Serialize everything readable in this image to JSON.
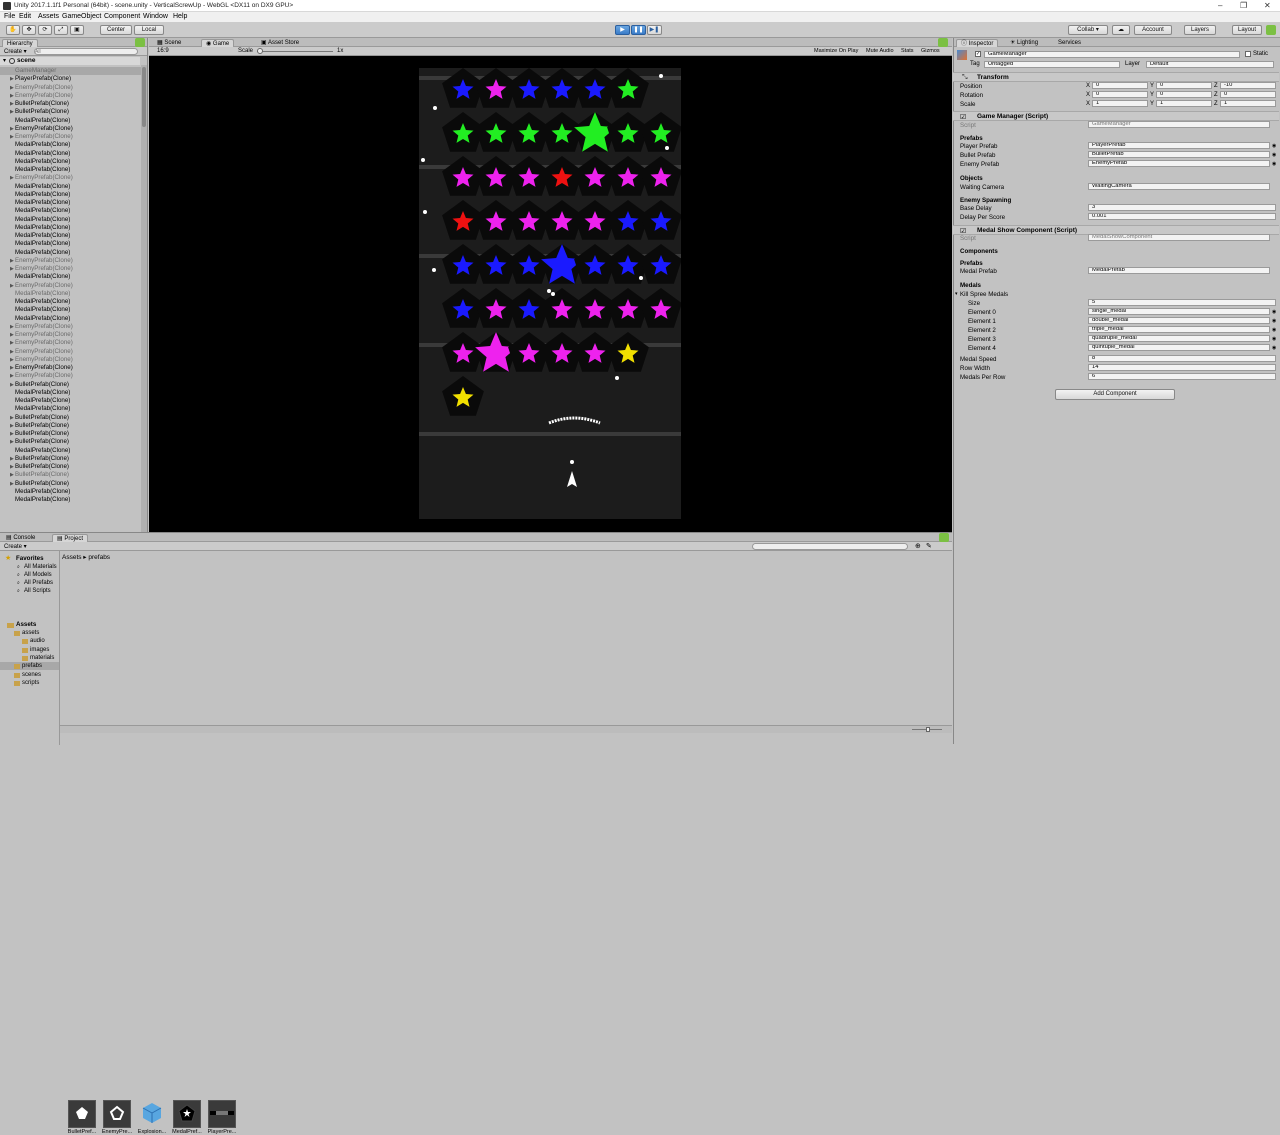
{
  "window": {
    "title": "Unity 2017.1.1f1 Personal (64bit) - scene.unity - VerticalScrewUp - WebGL <DX11 on DX9 GPU>"
  },
  "menu": [
    "File",
    "Edit",
    "Assets",
    "GameObject",
    "Component",
    "Window",
    "Help"
  ],
  "toolbar": {
    "pivot": "Center",
    "space": "Local",
    "collab": "Collab ▾",
    "account": "Account",
    "layers": "Layers",
    "layout": "Layout"
  },
  "hierarchy": {
    "tab": "Hierarchy",
    "create": "Create ▾",
    "search_placeholder": "All",
    "scene": "scene",
    "items": [
      {
        "label": "GameManager",
        "gray": false,
        "arrow": false,
        "selected": true
      },
      {
        "label": "PlayerPrefab(Clone)",
        "gray": false,
        "arrow": true
      },
      {
        "label": "EnemyPrefab(Clone)",
        "gray": true,
        "arrow": true
      },
      {
        "label": "EnemyPrefab(Clone)",
        "gray": true,
        "arrow": true
      },
      {
        "label": "BulletPrefab(Clone)",
        "gray": false,
        "arrow": true
      },
      {
        "label": "BulletPrefab(Clone)",
        "gray": false,
        "arrow": true
      },
      {
        "label": "MedalPrefab(Clone)",
        "gray": false,
        "arrow": false
      },
      {
        "label": "EnemyPrefab(Clone)",
        "gray": false,
        "arrow": true
      },
      {
        "label": "EnemyPrefab(Clone)",
        "gray": true,
        "arrow": true
      },
      {
        "label": "MedalPrefab(Clone)",
        "gray": false,
        "arrow": false
      },
      {
        "label": "MedalPrefab(Clone)",
        "gray": false,
        "arrow": false
      },
      {
        "label": "MedalPrefab(Clone)",
        "gray": false,
        "arrow": false
      },
      {
        "label": "MedalPrefab(Clone)",
        "gray": false,
        "arrow": false
      },
      {
        "label": "EnemyPrefab(Clone)",
        "gray": true,
        "arrow": true
      },
      {
        "label": "MedalPrefab(Clone)",
        "gray": false,
        "arrow": false
      },
      {
        "label": "MedalPrefab(Clone)",
        "gray": false,
        "arrow": false
      },
      {
        "label": "MedalPrefab(Clone)",
        "gray": false,
        "arrow": false
      },
      {
        "label": "MedalPrefab(Clone)",
        "gray": false,
        "arrow": false
      },
      {
        "label": "MedalPrefab(Clone)",
        "gray": false,
        "arrow": false
      },
      {
        "label": "MedalPrefab(Clone)",
        "gray": false,
        "arrow": false
      },
      {
        "label": "MedalPrefab(Clone)",
        "gray": false,
        "arrow": false
      },
      {
        "label": "MedalPrefab(Clone)",
        "gray": false,
        "arrow": false
      },
      {
        "label": "MedalPrefab(Clone)",
        "gray": false,
        "arrow": false
      },
      {
        "label": "EnemyPrefab(Clone)",
        "gray": true,
        "arrow": true
      },
      {
        "label": "EnemyPrefab(Clone)",
        "gray": true,
        "arrow": true
      },
      {
        "label": "MedalPrefab(Clone)",
        "gray": false,
        "arrow": false
      },
      {
        "label": "EnemyPrefab(Clone)",
        "gray": true,
        "arrow": true
      },
      {
        "label": "MedalPrefab(Clone)",
        "gray": true,
        "arrow": false
      },
      {
        "label": "MedalPrefab(Clone)",
        "gray": false,
        "arrow": false
      },
      {
        "label": "MedalPrefab(Clone)",
        "gray": false,
        "arrow": false
      },
      {
        "label": "MedalPrefab(Clone)",
        "gray": false,
        "arrow": false
      },
      {
        "label": "EnemyPrefab(Clone)",
        "gray": true,
        "arrow": true
      },
      {
        "label": "EnemyPrefab(Clone)",
        "gray": true,
        "arrow": true
      },
      {
        "label": "EnemyPrefab(Clone)",
        "gray": true,
        "arrow": true
      },
      {
        "label": "EnemyPrefab(Clone)",
        "gray": true,
        "arrow": true
      },
      {
        "label": "EnemyPrefab(Clone)",
        "gray": true,
        "arrow": true
      },
      {
        "label": "EnemyPrefab(Clone)",
        "gray": false,
        "arrow": true
      },
      {
        "label": "EnemyPrefab(Clone)",
        "gray": true,
        "arrow": true
      },
      {
        "label": "BulletPrefab(Clone)",
        "gray": false,
        "arrow": true
      },
      {
        "label": "MedalPrefab(Clone)",
        "gray": false,
        "arrow": false
      },
      {
        "label": "MedalPrefab(Clone)",
        "gray": false,
        "arrow": false
      },
      {
        "label": "MedalPrefab(Clone)",
        "gray": false,
        "arrow": false
      },
      {
        "label": "BulletPrefab(Clone)",
        "gray": false,
        "arrow": true
      },
      {
        "label": "BulletPrefab(Clone)",
        "gray": false,
        "arrow": true
      },
      {
        "label": "BulletPrefab(Clone)",
        "gray": false,
        "arrow": true
      },
      {
        "label": "BulletPrefab(Clone)",
        "gray": false,
        "arrow": true
      },
      {
        "label": "MedalPrefab(Clone)",
        "gray": false,
        "arrow": false
      },
      {
        "label": "BulletPrefab(Clone)",
        "gray": false,
        "arrow": true
      },
      {
        "label": "BulletPrefab(Clone)",
        "gray": false,
        "arrow": true
      },
      {
        "label": "BulletPrefab(Clone)",
        "gray": true,
        "arrow": true
      },
      {
        "label": "BulletPrefab(Clone)",
        "gray": false,
        "arrow": true
      },
      {
        "label": "MedalPrefab(Clone)",
        "gray": false,
        "arrow": false
      },
      {
        "label": "MedalPrefab(Clone)",
        "gray": false,
        "arrow": false
      }
    ]
  },
  "game_view": {
    "tabs": [
      "Scene",
      "Game",
      "Asset Store"
    ],
    "aspect": "16:9",
    "scale_label": "Scale",
    "scale_value": "1x",
    "options": [
      "Maximize On Play",
      "Mute Audio",
      "Stats",
      "Gizmos"
    ]
  },
  "inspector": {
    "tabs": [
      "Inspector",
      "Lighting",
      "Services"
    ],
    "object_name": "GameManager",
    "static_label": "Static",
    "tag_label": "Tag",
    "tag_value": "Untagged",
    "layer_label": "Layer",
    "layer_value": "Default",
    "transform": {
      "title": "Transform",
      "rows": [
        {
          "label": "Position",
          "x": "0",
          "y": "0",
          "z": "-10"
        },
        {
          "label": "Rotation",
          "x": "0",
          "y": "0",
          "z": "0"
        },
        {
          "label": "Scale",
          "x": "1",
          "y": "1",
          "z": "1"
        }
      ]
    },
    "game_manager": {
      "title": "Game Manager (Script)",
      "script_label": "Script",
      "script_value": "GameManager",
      "prefabs_header": "Prefabs",
      "prefabs": [
        {
          "label": "Player Prefab",
          "value": "PlayerPrefab"
        },
        {
          "label": "Bullet Prefab",
          "value": "BulletPrefab"
        },
        {
          "label": "Enemy Prefab",
          "value": "EnemyPrefab"
        }
      ],
      "objects_header": "Objects",
      "waiting_camera_label": "Waiting Camera",
      "waiting_camera_value": "WaitingCamera",
      "spawning_header": "Enemy Spawning",
      "base_delay_label": "Base Delay",
      "base_delay_value": "3",
      "delay_per_score_label": "Delay Per Score",
      "delay_per_score_value": "0.001"
    },
    "medal_show": {
      "title": "Medal Show Component (Script)",
      "script_label": "Script",
      "script_value": "MedalShowComponent",
      "components_header": "Components",
      "prefabs_header": "Prefabs",
      "medal_prefab_label": "Medal Prefab",
      "medal_prefab_value": "MedalPrefab",
      "medals_header": "Medals",
      "kill_spree_label": "Kill Spree Medals",
      "size_label": "Size",
      "size_value": "5",
      "elements": [
        {
          "label": "Element 0",
          "value": "single_medal"
        },
        {
          "label": "Element 1",
          "value": "double_medal"
        },
        {
          "label": "Element 2",
          "value": "triple_medal"
        },
        {
          "label": "Element 3",
          "value": "quadruple_medal"
        },
        {
          "label": "Element 4",
          "value": "quintuple_medal"
        }
      ],
      "medal_speed_label": "Medal Speed",
      "medal_speed_value": "8",
      "row_width_label": "Row Width",
      "row_width_value": "14",
      "medals_per_row_label": "Medals Per Row",
      "medals_per_row_value": "6"
    },
    "add_component": "Add Component"
  },
  "bottom": {
    "tabs": [
      "Console",
      "Project"
    ],
    "create": "Create ▾",
    "breadcrumb": "Assets ▸ prefabs",
    "favorites_header": "Favorites",
    "favorites": [
      "All Materials",
      "All Models",
      "All Prefabs",
      "All Scripts"
    ],
    "assets_header": "Assets",
    "tree": [
      {
        "label": "assets",
        "level": 1
      },
      {
        "label": "audio",
        "level": 2
      },
      {
        "label": "images",
        "level": 2
      },
      {
        "label": "materials",
        "level": 2
      },
      {
        "label": "prefabs",
        "level": 1,
        "selected": true
      },
      {
        "label": "scenes",
        "level": 1
      },
      {
        "label": "scripts",
        "level": 1
      }
    ],
    "assets": [
      {
        "label": "BulletPref...",
        "icon": "bullet-prefab-icon"
      },
      {
        "label": "EnemyPre...",
        "icon": "enemy-prefab-icon"
      },
      {
        "label": "Explosion...",
        "icon": "explosion-prefab-icon"
      },
      {
        "label": "MedalPref...",
        "icon": "medal-prefab-icon"
      },
      {
        "label": "PlayerPre...",
        "icon": "player-prefab-icon"
      }
    ]
  },
  "colors": {
    "star_blue": "#1a1aff",
    "star_green": "#22ee22",
    "star_magenta": "#ee22ee",
    "star_red": "#ee1111",
    "star_yellow": "#f2e000",
    "enemy_pentagon": "#0a0a0a",
    "game_bg": "#1c1c1c"
  }
}
